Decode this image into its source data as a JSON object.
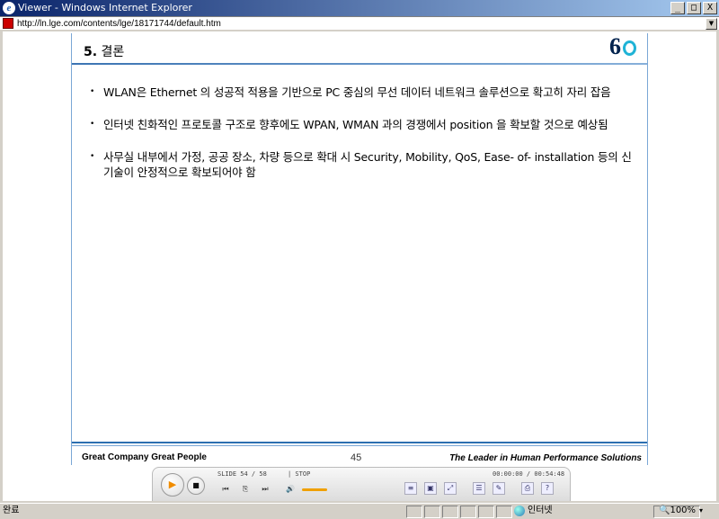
{
  "window": {
    "title": "Viewer - Windows Internet Explorer",
    "minimize": "_",
    "maximize": "□",
    "close": "X"
  },
  "address": {
    "url": "http://ln.lge.com/contents/lge/18171744/default.htm"
  },
  "slide": {
    "title_number": "5.",
    "title_text": "결론",
    "logo_text": "6",
    "bullets": [
      "WLAN은 Ethernet 의 성공적 적용을 기반으로 PC 중심의 무선 데이터 네트워크 솔루션으로 확고히 자리 잡음",
      "인터넷 친화적인 프로토콜 구조로 향후에도 WPAN, WMAN  과의 경쟁에서 position 을 확보할 것으로 예상됨",
      "사무실 내부에서 가정, 공공 장소, 차량 등으로 확대 시 Security, Mobility, QoS,  Ease- of- installation 등의 신기술이 안정적으로 확보되어야 함"
    ],
    "footer_left": "Great Company   Great People",
    "page_number": "45",
    "footer_right": "The Leader in Human Performance Solutions"
  },
  "player": {
    "slide_info": "SLIDE 54 / 58",
    "state": "| STOP",
    "time": "00:00:00 / 00:54:48",
    "play": "▶",
    "stop": "■",
    "prev": "⏮",
    "pages": "⎘",
    "next": "⏭",
    "volume": "🔊",
    "help": "?"
  },
  "status": {
    "text": "완료",
    "zone": "인터넷",
    "zoom": "100%",
    "zoom_dropdown": "▾"
  }
}
